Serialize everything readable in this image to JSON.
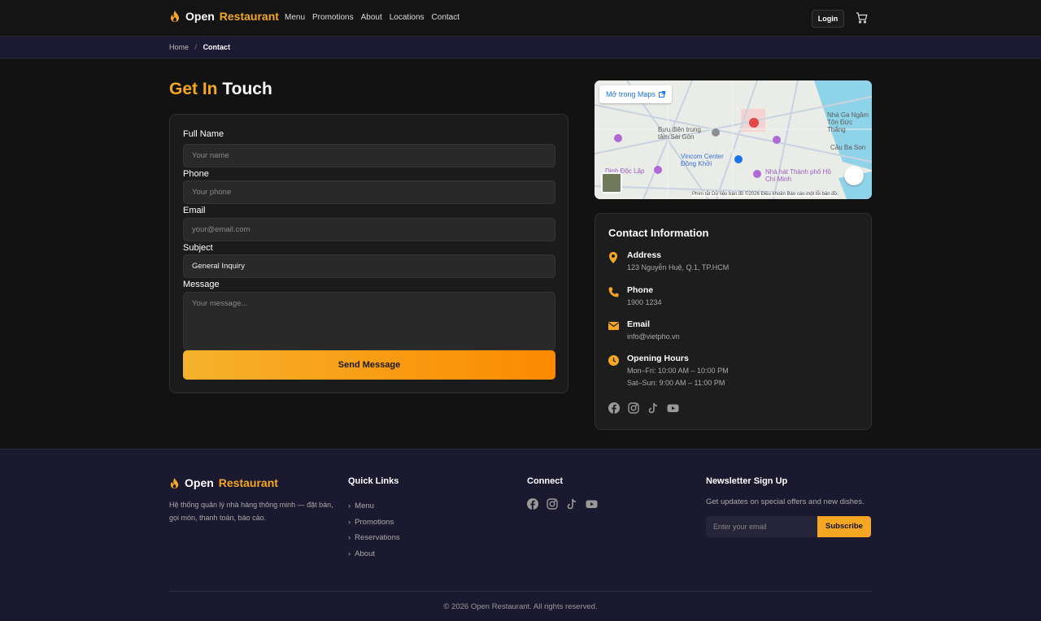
{
  "header": {
    "brand_prefix": "Open",
    "brand_accent": "Restaurant",
    "nav": [
      "Menu",
      "Promotions",
      "About",
      "Locations",
      "Contact"
    ],
    "login_label": "Login",
    "cart_icon": "cart-icon"
  },
  "breadcrumb": {
    "home": "Home",
    "separator": "/",
    "current": "Contact"
  },
  "page": {
    "title_accent": "Get In",
    "title_rest": "Touch"
  },
  "form": {
    "full_name_label": "Full Name",
    "full_name_placeholder": "Your name",
    "phone_label": "Phone",
    "phone_placeholder": "Your phone",
    "email_label": "Email",
    "email_placeholder": "your@email.com",
    "subject_label": "Subject",
    "subject_value": "General Inquiry",
    "message_label": "Message",
    "message_placeholder": "Your message...",
    "submit_label": "Send Message"
  },
  "map": {
    "open_in_maps": "Mở trong Maps",
    "labels": [
      "Bưu điện trung tâm Sài Gòn",
      "Vincom Center Đồng Khởi",
      "Nhà hát Thành phố Hồ Chí Minh",
      "Dinh Độc Lập",
      "Nhà Ga Ngầm Tôn Đức Thắng",
      "Cầu Ba Son"
    ],
    "footer": "Phím tắt   Dữ liệu bản đồ ©2026   Điều khoản   Báo cáo một lỗi bản đồ"
  },
  "contact": {
    "title": "Contact Information",
    "address_label": "Address",
    "address_value": "123 Nguyễn Huệ, Q.1, TP.HCM",
    "phone_label": "Phone",
    "phone_value": "1900 1234",
    "email_label": "Email",
    "email_value": "info@vietpho.vn",
    "hours_label": "Opening Hours",
    "hours_weekday": "Mon–Fri: 10:00 AM – 10:00 PM",
    "hours_weekend": "Sat–Sun: 9:00 AM – 11:00 PM",
    "socials": [
      "facebook-icon",
      "instagram-icon",
      "tiktok-icon",
      "youtube-icon"
    ]
  },
  "footer": {
    "brand_prefix": "Open",
    "brand_accent": "Restaurant",
    "description": "Hệ thống quản lý nhà hàng thông minh — đặt bàn, gọi món, thanh toán, báo cáo.",
    "quick_links_title": "Quick Links",
    "quick_links": [
      "Menu",
      "Promotions",
      "Reservations",
      "About"
    ],
    "connect_title": "Connect",
    "newsletter_title": "Newsletter Sign Up",
    "newsletter_text": "Get updates on special offers and new dishes.",
    "newsletter_placeholder": "Enter your email",
    "subscribe_label": "Subscribe",
    "copyright": "© 2026 Open Restaurant. All rights reserved."
  },
  "colors": {
    "accent": "#f5a623",
    "background": "#121212",
    "footer": "#1b1930"
  }
}
